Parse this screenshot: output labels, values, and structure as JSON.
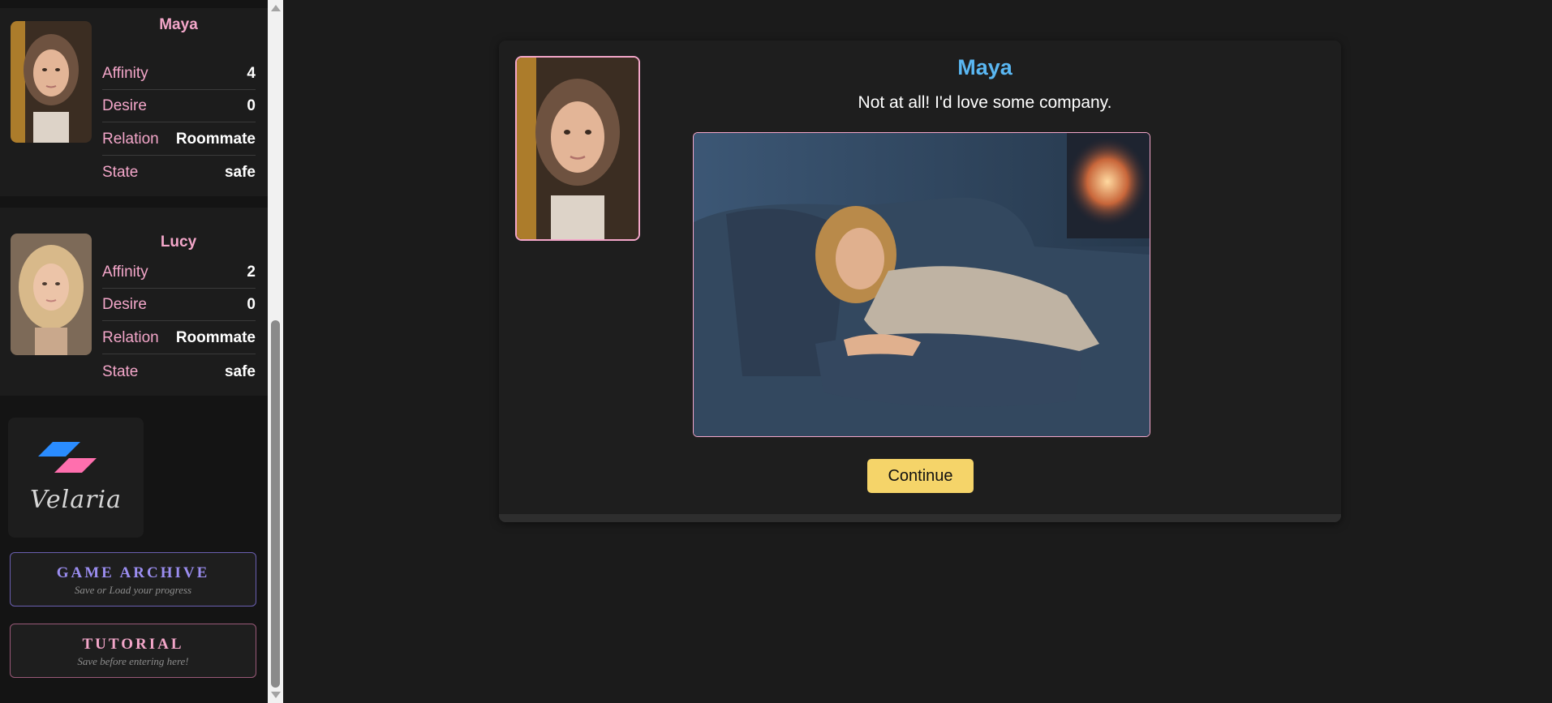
{
  "sidebar": {
    "characters": [
      {
        "name": "Maya",
        "stats": [
          {
            "label": "Affinity",
            "value": "4"
          },
          {
            "label": "Desire",
            "value": "0"
          },
          {
            "label": "Relation",
            "value": "Roommate"
          },
          {
            "label": "State",
            "value": "safe"
          }
        ]
      },
      {
        "name": "Lucy",
        "stats": [
          {
            "label": "Affinity",
            "value": "2"
          },
          {
            "label": "Desire",
            "value": "0"
          },
          {
            "label": "Relation",
            "value": "Roommate"
          },
          {
            "label": "State",
            "value": "safe"
          }
        ]
      }
    ],
    "logo_text": "Velaria",
    "archive": {
      "title": "GAME ARCHIVE",
      "subtitle": "Save or Load your progress"
    },
    "tutorial": {
      "title": "TUTORIAL",
      "subtitle": "Save before entering here!"
    }
  },
  "dialogue": {
    "speaker": "Maya",
    "text": "Not at all! I'd love some company.",
    "continue_label": "Continue"
  },
  "colors": {
    "accent_pink": "#f3a6c9",
    "speaker_blue": "#5ab7f2",
    "continue_yellow": "#f5d469",
    "logo_blue": "#2a8cff",
    "logo_pink": "#ff6fae",
    "archive_purple": "#9b8df0"
  }
}
